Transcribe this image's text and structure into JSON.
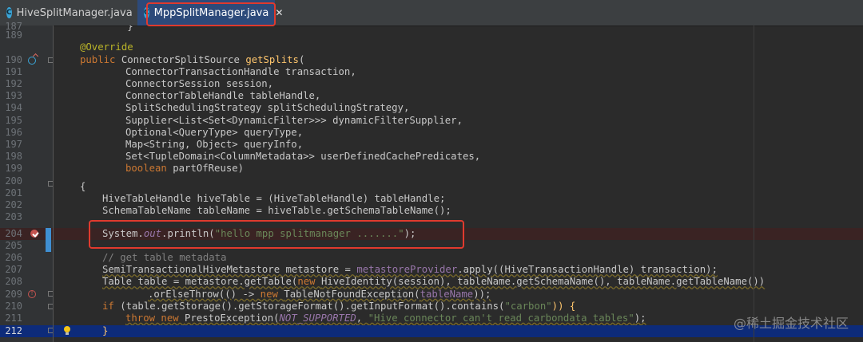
{
  "tabs": [
    {
      "label": "HiveSplitManager.java",
      "icon": "C",
      "active": false
    },
    {
      "label": "MppSplitManager.java",
      "icon": "C",
      "active": true
    }
  ],
  "gutter": {
    "line_numbers": [
      "187",
      "189",
      "190",
      "191",
      "192",
      "193",
      "194",
      "195",
      "196",
      "197",
      "198",
      "199",
      "200",
      "201",
      "202",
      "203",
      "204",
      "205",
      "206",
      "207",
      "208",
      "209",
      "210",
      "211",
      "212"
    ]
  },
  "code": {
    "l187": "        }",
    "l189_ann": "@Override",
    "l190_kw": "public ",
    "l190_type": "ConnectorSplitSource ",
    "l190_fn": "getSplits",
    "l190_rest": "(",
    "l191": "ConnectorTransactionHandle transaction,",
    "l192": "ConnectorSession session,",
    "l193": "ConnectorTableHandle tableHandle,",
    "l194": "SplitSchedulingStrategy splitSchedulingStrategy,",
    "l195": "Supplier<List<Set<DynamicFilter>>> dynamicFilterSupplier,",
    "l196": "Optional<QueryType> queryType,",
    "l197": "Map<String, Object> queryInfo,",
    "l198": "Set<TupleDomain<ColumnMetadata>> userDefinedCachePredicates,",
    "l199_kw": "boolean ",
    "l199_rest": "partOfReuse)",
    "l200": "{",
    "l201": "HiveTableHandle hiveTable = (HiveTableHandle) tableHandle;",
    "l202": "SchemaTableName tableName = hiveTable.getSchemaTableName();",
    "l204_a": "System.",
    "l204_out": "out",
    "l204_b": ".println(",
    "l204_str": "\"hello mpp splitmanager .......\"",
    "l204_c": ");",
    "l206": "// get table metadata",
    "l207_a": "SemiTransactionalHiveMetastore metastore = ",
    "l207_fld": "metastoreProvider",
    "l207_b": ".apply((HiveTransactionHandle) transaction);",
    "l208_a": "Table table = metastore.getTable(",
    "l208_new": "new ",
    "l208_b": "HiveIdentity(session), tableName.getSchemaName(), tableName.getTableName())",
    "l209_a": ".orElseThrow(() -> ",
    "l209_new": "new ",
    "l209_b": "TableNotFoundException(",
    "l209_var": "tableName",
    "l209_c": "));",
    "l210_if": "if ",
    "l210_a": "(table.getStorage().getStorageFormat().getInputFormat().contains(",
    "l210_str": "\"carbon\"",
    "l210_b": ")) {",
    "l211_kw": "throw new ",
    "l211_a": "PrestoException(",
    "l211_const": "NOT_SUPPORTED",
    "l211_b": ", ",
    "l211_str": "\"Hive connector can't read carbondata tables\"",
    "l211_c": ");",
    "l212": "}"
  },
  "watermark": "@稀土掘金技术社区",
  "colors": {
    "keyword": "#cc7832",
    "annotation": "#bbb529",
    "function": "#ffc66d",
    "string": "#6a8759",
    "comment": "#808080",
    "highlight_box": "#e03a2e"
  }
}
